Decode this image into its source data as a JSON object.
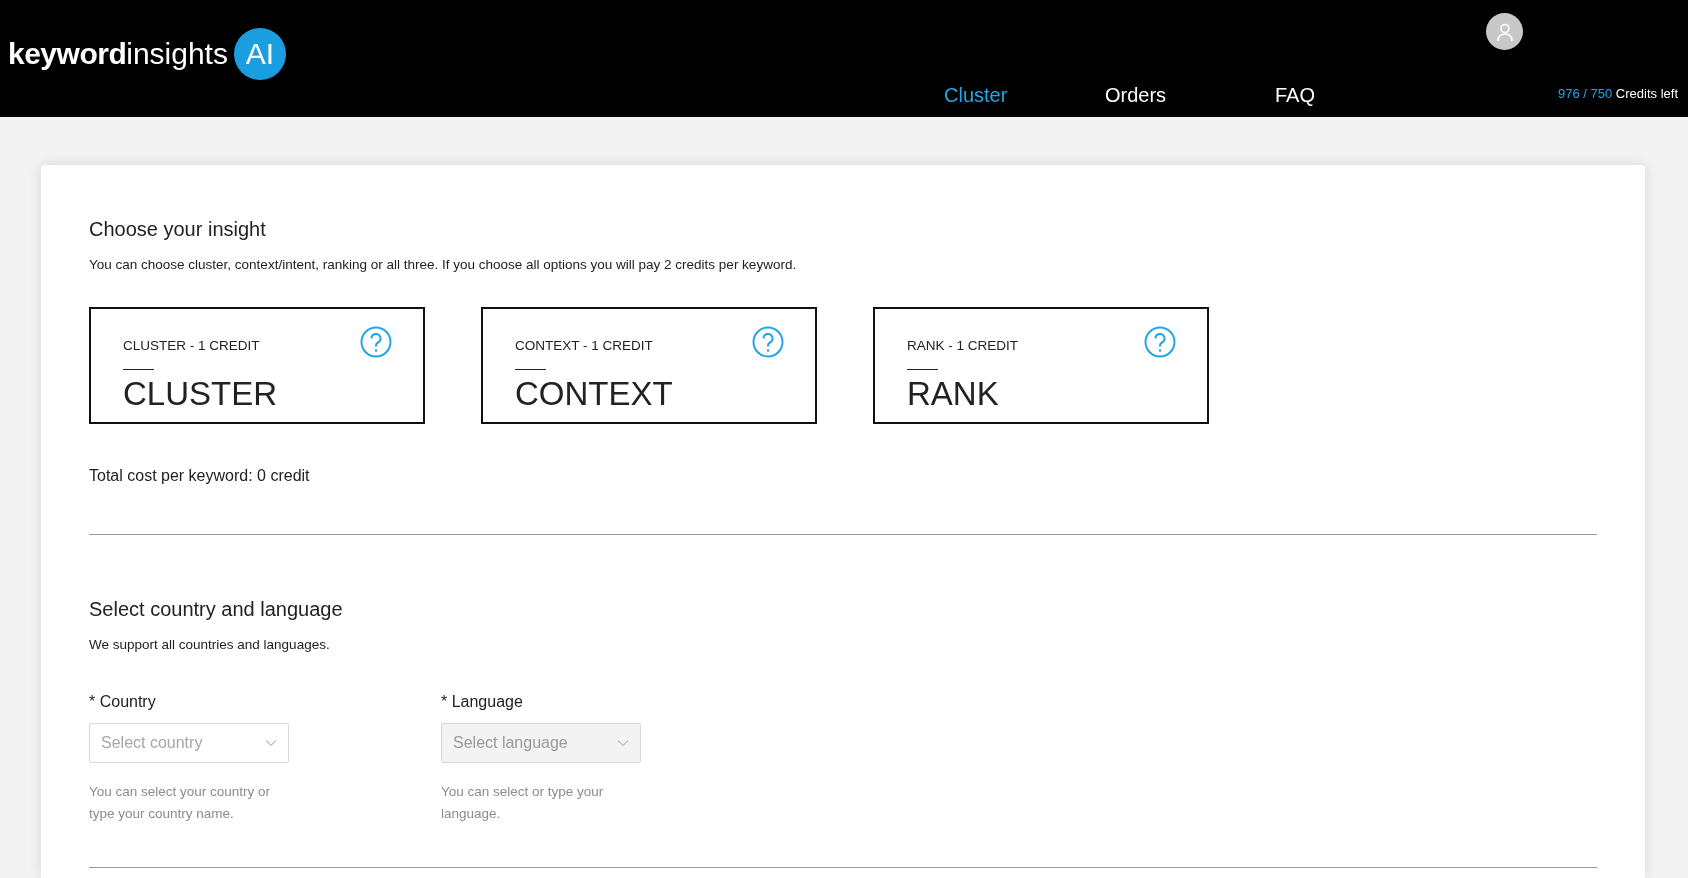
{
  "logo": {
    "bold": "keyword",
    "light": "insights",
    "badge": "AI"
  },
  "nav": [
    {
      "label": "Cluster",
      "selected": true
    },
    {
      "label": "Orders",
      "selected": false
    },
    {
      "label": "FAQ",
      "selected": false
    }
  ],
  "credits": {
    "amount": "976 / 750",
    "label": "Credits left"
  },
  "insight": {
    "title": "Choose your insight",
    "description": "You can choose cluster, context/intent, ranking or all three. If you choose all options you will pay 2 credits per keyword.",
    "options": [
      {
        "caption": "CLUSTER - 1 CREDIT",
        "name": "CLUSTER",
        "selected": false
      },
      {
        "caption": "CONTEXT - 1 CREDIT",
        "name": "CONTEXT",
        "selected": false
      },
      {
        "caption": "RANK - 1 CREDIT",
        "name": "RANK",
        "selected": false
      }
    ],
    "total": "Total cost per keyword: 0 credit"
  },
  "location": {
    "title": "Select country and language",
    "description": "We support all countries and languages.",
    "fields": [
      {
        "label": "* Country",
        "placeholder": "Select country",
        "disabled": false,
        "help": "You can select your country or type your country name."
      },
      {
        "label": "* Language",
        "placeholder": "Select language",
        "disabled": true,
        "help": "You can select or type your language."
      }
    ]
  }
}
